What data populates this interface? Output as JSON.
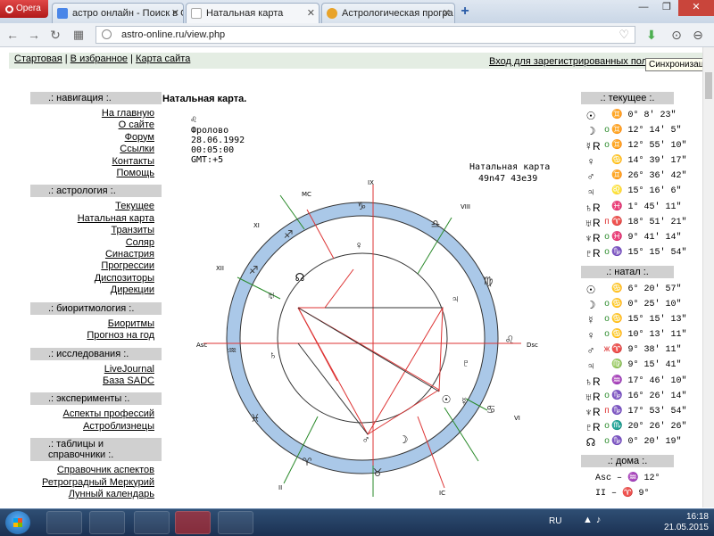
{
  "browser": {
    "menu_label": "Opera",
    "tabs": [
      {
        "label": "астро онлайн - Поиск в G",
        "active": false
      },
      {
        "label": "Натальная карта",
        "active": true
      },
      {
        "label": "Астрологическая програ",
        "active": false
      }
    ],
    "new_tab": "+",
    "url": "astro-online.ru/view.php"
  },
  "page": {
    "top_links": [
      "Стартовая",
      "В избранное",
      "Карта сайта"
    ],
    "top_sep": "|",
    "login": "Вход для зарегистрированных польз",
    "tooltip": "Синхронизация",
    "content_title": "Натальная карта.",
    "left_sections": [
      {
        "title": ".: навигация :.",
        "items": [
          "На главную",
          "О сайте",
          "Форум",
          "Ссылки",
          "Контакты",
          "Помощь"
        ]
      },
      {
        "title": ".: астрология :.",
        "items": [
          "Текущее",
          "Натальная карта",
          "Транзиты",
          "Соляр",
          "Синастрия",
          "Прогрессии",
          "Диспозиторы",
          "Дирекции"
        ]
      },
      {
        "title": ".: биоритмология :.",
        "items": [
          "Биоритмы",
          "Прогноз на год"
        ]
      },
      {
        "title": ".: исследования :.",
        "items": [
          "LiveJournal",
          "База SADC"
        ]
      },
      {
        "title": ".: эксперименты :.",
        "items": [
          "Аспекты профессий",
          "Астроблизнецы"
        ]
      },
      {
        "title": ".: таблицы и справочники :.",
        "items": [
          "Справочник аспектов",
          "Ретроградный Меркурий",
          "Лунный календарь"
        ]
      }
    ],
    "chart_info": {
      "symbol": "♌",
      "name": "Фролово",
      "date": "28.06.1992",
      "time": "00:05:00",
      "gmt": "GMT:+5",
      "title": "Натальная карта",
      "coords": "49n47  43e39"
    },
    "current_header": ".: текущее :.",
    "current": [
      {
        "planet": "☉",
        "status": "",
        "pos": "♊ 0° 8' 23\""
      },
      {
        "planet": "☽",
        "status": "o",
        "pos": "♊ 12° 14' 5\""
      },
      {
        "planet": "☿R",
        "status": "o",
        "pos": "♊ 12° 55' 10\""
      },
      {
        "planet": "♀",
        "status": "",
        "pos": "♋ 14° 39' 17\""
      },
      {
        "planet": "♂",
        "status": "",
        "pos": "♊ 26° 36' 42\""
      },
      {
        "planet": "♃",
        "status": "",
        "pos": "♌ 15° 16' 6\""
      },
      {
        "planet": "♄R",
        "status": "",
        "pos": "♓ 1° 45' 11\""
      },
      {
        "planet": "♅R",
        "status": "п",
        "pos": "♈ 18° 51' 21\""
      },
      {
        "planet": "♆R",
        "status": "o",
        "pos": "♓ 9° 41' 14\""
      },
      {
        "planet": "♇R",
        "status": "o",
        "pos": "♑ 15° 15' 54\""
      }
    ],
    "natal_header": ".: натал :.",
    "natal": [
      {
        "planet": "☉",
        "status": "",
        "pos": "♋ 6° 20' 57\""
      },
      {
        "planet": "☽",
        "status": "o",
        "pos": "♋ 0° 25' 10\""
      },
      {
        "planet": "☿",
        "status": "o",
        "pos": "♋ 15° 15' 13\""
      },
      {
        "planet": "♀",
        "status": "o",
        "pos": "♋ 10° 13' 11\""
      },
      {
        "planet": "♂",
        "status": "ж",
        "pos": "♈ 9° 38' 11\""
      },
      {
        "planet": "♃",
        "status": "",
        "pos": "♍ 9° 15' 41\""
      },
      {
        "planet": "♄R",
        "status": "",
        "pos": "♒ 17° 46' 10\""
      },
      {
        "planet": "♅R",
        "status": "o",
        "pos": "♑ 16° 26' 14\""
      },
      {
        "planet": "♆R",
        "status": "п",
        "pos": "♑ 17° 53' 54\""
      },
      {
        "planet": "♇R",
        "status": "o",
        "pos": "♏ 20° 26' 26\""
      },
      {
        "planet": "☊",
        "status": "o",
        "pos": "♑ 0° 20' 19\""
      }
    ],
    "houses_header": ".: дома :.",
    "houses": [
      "Asc – ♒ 12°",
      "II – ♈ 9°"
    ]
  },
  "taskbar": {
    "lang": "RU",
    "time": "16:18",
    "date": "21.05.2015"
  }
}
